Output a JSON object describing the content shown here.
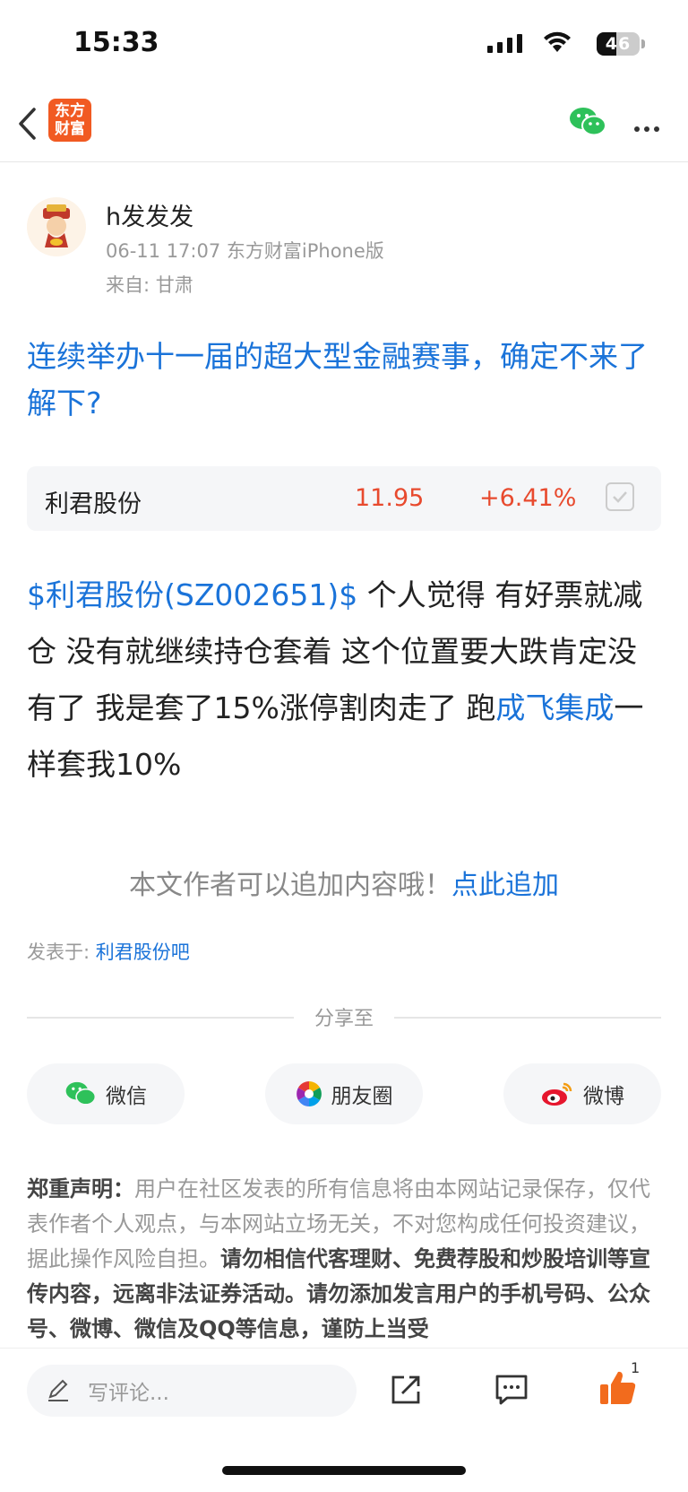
{
  "status": {
    "time": "15:33",
    "battery": "46"
  },
  "header": {
    "logo_line1": "东方",
    "logo_line2": "财富"
  },
  "post": {
    "author": "h发发发",
    "meta": "06-11 17:07 东方财富iPhone版",
    "from": "来自: 甘肃",
    "title": "连续举办十一届的超大型金融赛事，确定不来了解下?",
    "stock": {
      "name": "利君股份",
      "price": "11.95",
      "change": "+6.41%"
    },
    "body_link": "$利君股份(SZ002651)$",
    "body_text": "  个人觉得 有好票就减仓 没有就继续持仓套着 这个位置要大跌肯定没有了 我是套了15%涨停割肉走了  跑",
    "body_link2": "成飞集成",
    "body_text2": "一样套我10%",
    "append_prompt": "本文作者可以追加内容哦！",
    "append_link": "点此追加",
    "posted_in_label": "发表于: ",
    "posted_in_link": "利君股份吧"
  },
  "share": {
    "label": "分享至",
    "wechat": "微信",
    "moments": "朋友圈",
    "weibo": "微博"
  },
  "disclaimer": {
    "head": "郑重声明：",
    "gray1": "用户在社区发表的所有信息将由本网站记录保存，仅代表作者个人观点，与本网站立场无关，不对您构成任何投资建议，据此操作风险自担。",
    "bold1": "请勿相信代客理财、免费荐股和炒股培训等宣传内容，远离非法证券活动。请勿添加发言用户的手机号码、公众号、微博、微信及QQ等信息，谨防上当受"
  },
  "bottom": {
    "comment_placeholder": "写评论...",
    "like_count": "1"
  },
  "colors": {
    "link": "#1a73d9",
    "rise": "#e84a2e",
    "brand": "#f15a22",
    "like": "#f26b1d"
  }
}
